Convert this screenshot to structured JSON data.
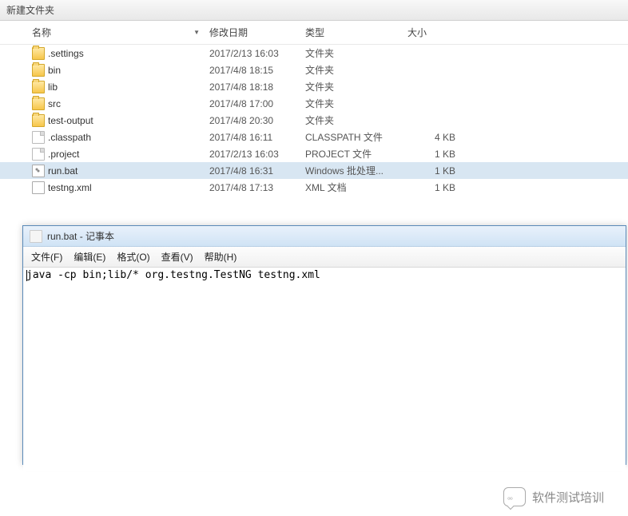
{
  "toolbar": {
    "new_folder": "新建文件夹"
  },
  "headers": {
    "name": "名称",
    "date": "修改日期",
    "type": "类型",
    "size": "大小"
  },
  "files": [
    {
      "name": ".settings",
      "date": "2017/2/13 16:03",
      "type": "文件夹",
      "size": "",
      "icon": "folder",
      "selected": false
    },
    {
      "name": "bin",
      "date": "2017/4/8 18:15",
      "type": "文件夹",
      "size": "",
      "icon": "folder",
      "selected": false
    },
    {
      "name": "lib",
      "date": "2017/4/8 18:18",
      "type": "文件夹",
      "size": "",
      "icon": "folder",
      "selected": false
    },
    {
      "name": "src",
      "date": "2017/4/8 17:00",
      "type": "文件夹",
      "size": "",
      "icon": "folder",
      "selected": false
    },
    {
      "name": "test-output",
      "date": "2017/4/8 20:30",
      "type": "文件夹",
      "size": "",
      "icon": "folder",
      "selected": false
    },
    {
      "name": ".classpath",
      "date": "2017/4/8 16:11",
      "type": "CLASSPATH 文件",
      "size": "4 KB",
      "icon": "file",
      "selected": false
    },
    {
      "name": ".project",
      "date": "2017/2/13 16:03",
      "type": "PROJECT 文件",
      "size": "1 KB",
      "icon": "file",
      "selected": false
    },
    {
      "name": "run.bat",
      "date": "2017/4/8 16:31",
      "type": "Windows 批处理...",
      "size": "1 KB",
      "icon": "bat",
      "selected": true
    },
    {
      "name": "testng.xml",
      "date": "2017/4/8 17:13",
      "type": "XML 文档",
      "size": "1 KB",
      "icon": "xml",
      "selected": false
    }
  ],
  "notepad": {
    "title": "run.bat - 记事本",
    "menu": {
      "file": "文件(F)",
      "edit": "编辑(E)",
      "format": "格式(O)",
      "view": "查看(V)",
      "help": "帮助(H)"
    },
    "content": "java -cp bin;lib/* org.testng.TestNG testng.xml"
  },
  "watermark": "软件测试培训"
}
